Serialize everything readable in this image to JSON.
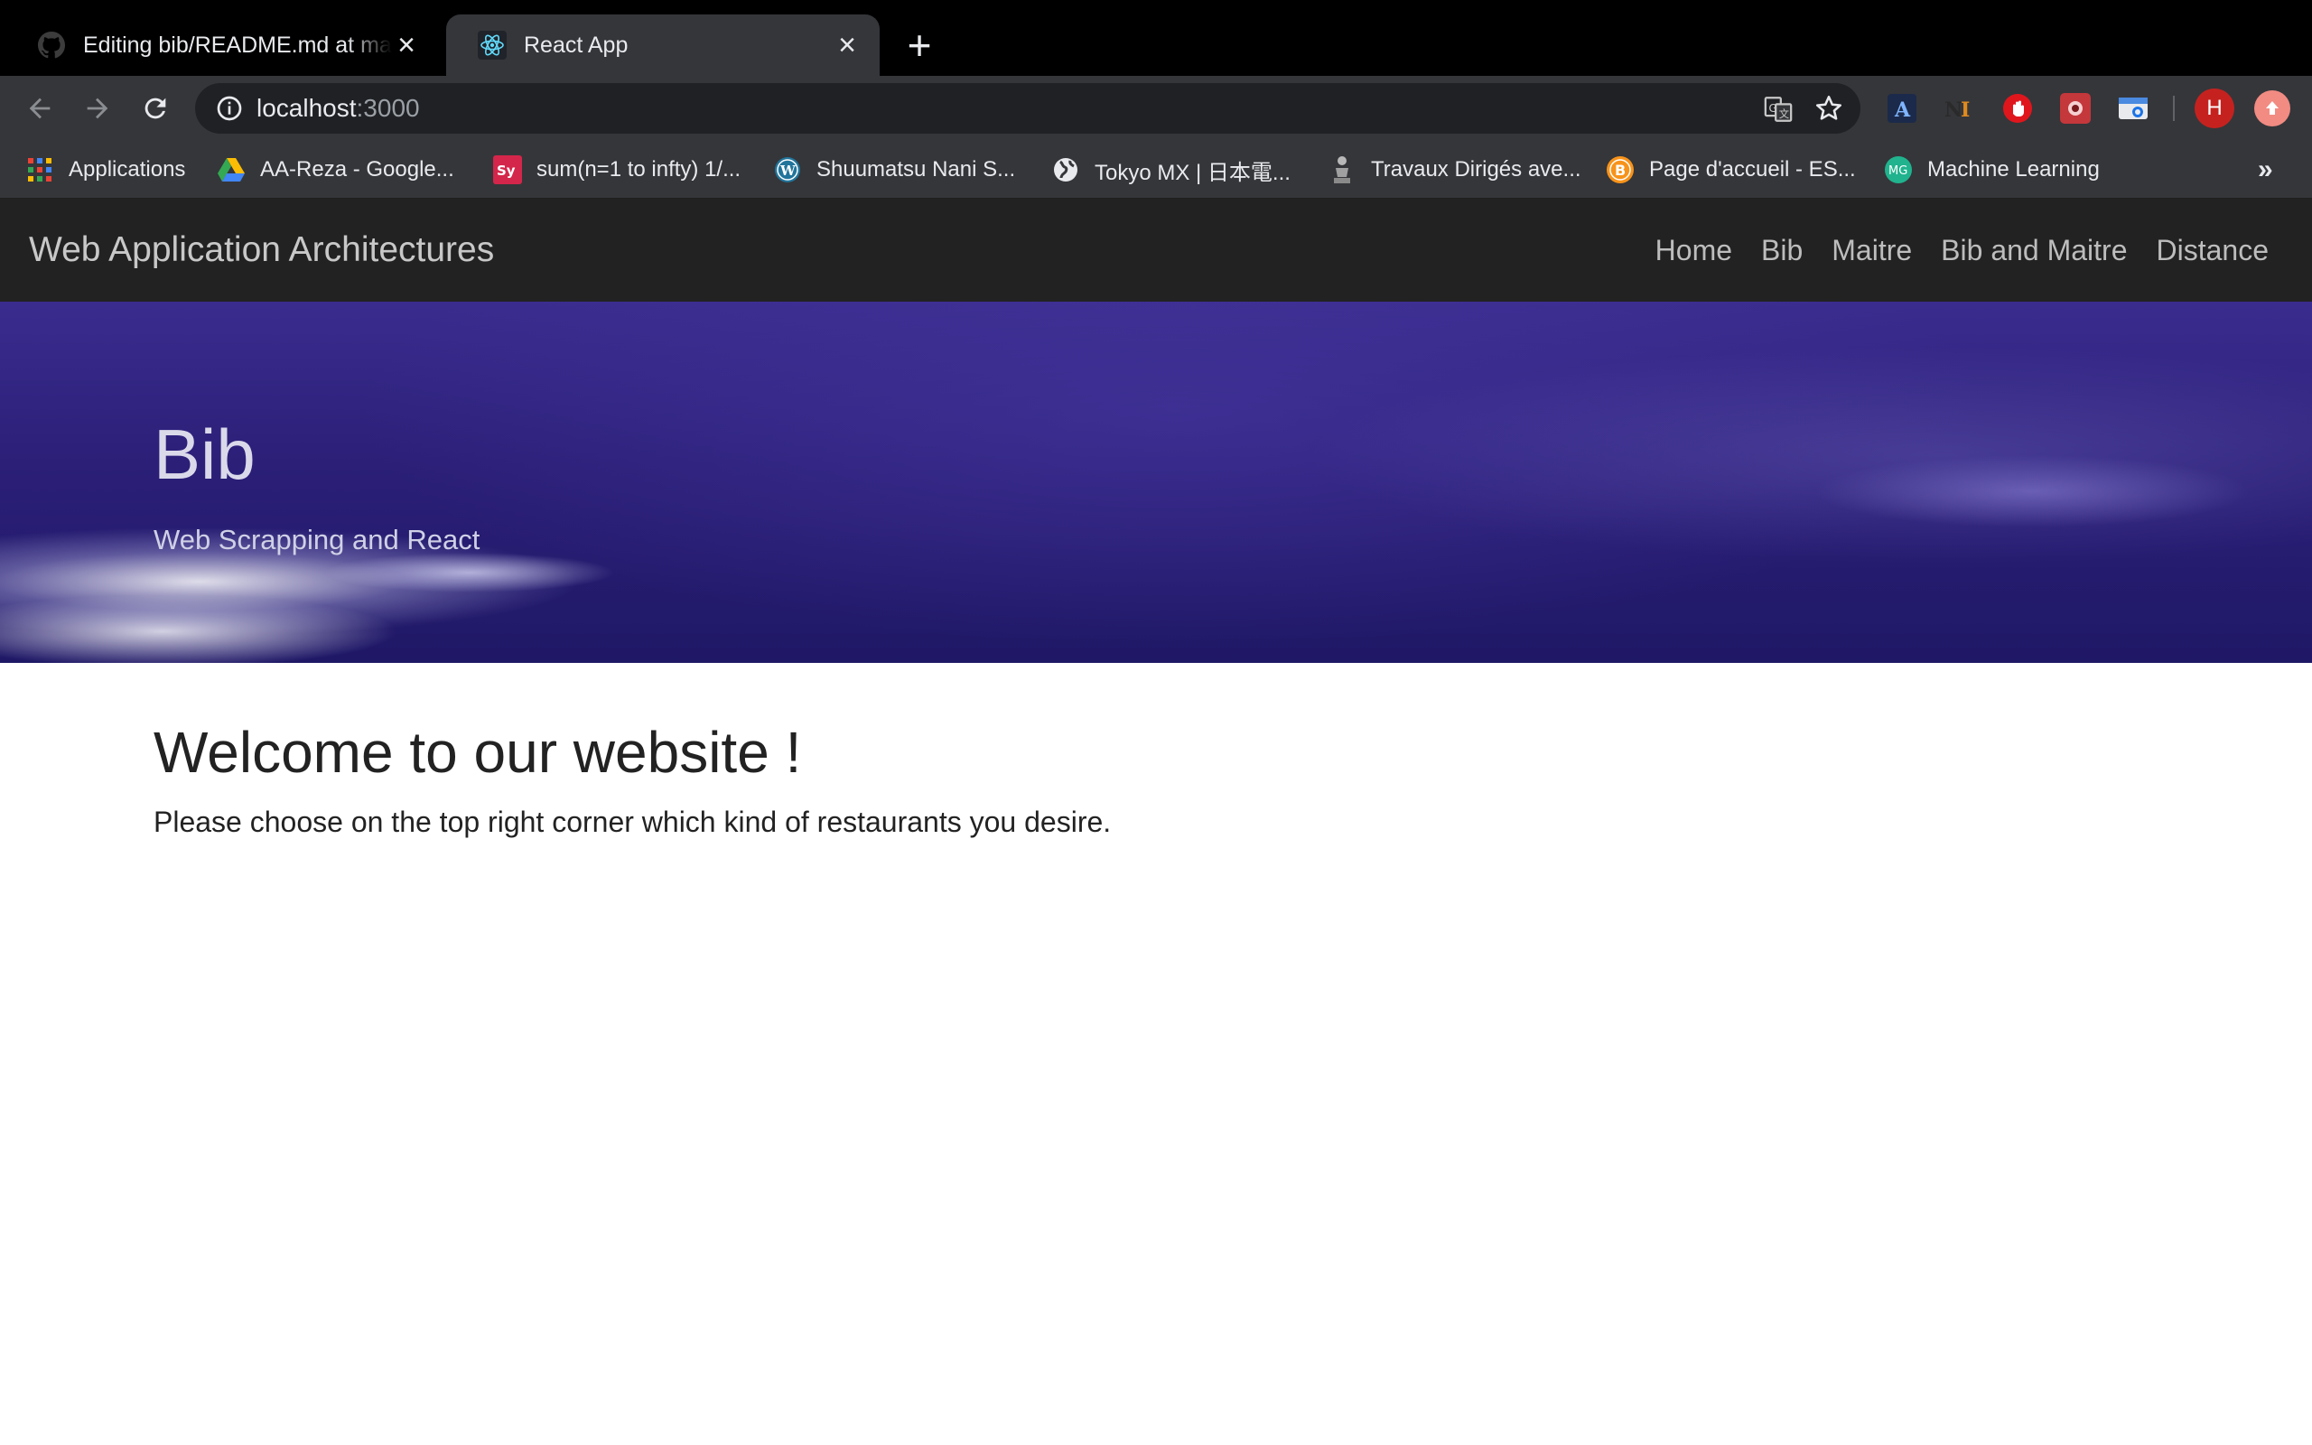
{
  "browser": {
    "tabs": [
      {
        "title": "Editing bib/README.md at master",
        "favicon": "github-icon",
        "active": false
      },
      {
        "title": "React App",
        "favicon": "react-icon",
        "active": true
      }
    ],
    "new_tab_icon": "plus-icon",
    "address": {
      "host": "localhost",
      "port": ":3000"
    },
    "bookmarks": [
      {
        "label": "Applications",
        "icon": "apps-grid-icon"
      },
      {
        "label": "AA-Reza - Google...",
        "icon": "google-drive-icon"
      },
      {
        "label": "sum(n=1 to infty) 1/...",
        "icon": "symbolab-icon"
      },
      {
        "label": "Shuumatsu Nani S...",
        "icon": "wordpress-icon"
      },
      {
        "label": "Tokyo MX | 日本電...",
        "icon": "globe-icon"
      },
      {
        "label": "Travaux Dirigés ave...",
        "icon": "statue-icon"
      },
      {
        "label": "Page d'accueil - ES...",
        "icon": "bitcoin-icon"
      },
      {
        "label": "Machine Learning",
        "icon": "mg-icon"
      }
    ],
    "bookmarks_more": "»",
    "profile_initial": "H"
  },
  "site": {
    "brand": "Web Application Architectures",
    "nav": [
      "Home",
      "Bib",
      "Maitre",
      "Bib and Maitre",
      "Distance"
    ],
    "hero": {
      "title": "Bib",
      "subtitle": "Web Scrapping and React"
    },
    "welcome": "Welcome to our website !",
    "intro": "Please choose on the top right corner which kind of restaurants you desire."
  },
  "colors": {
    "tabstrip_bg": "#000000",
    "toolbar_bg": "#35363a",
    "navbar_bg": "#222222",
    "hero_base": "#2b1f78"
  }
}
